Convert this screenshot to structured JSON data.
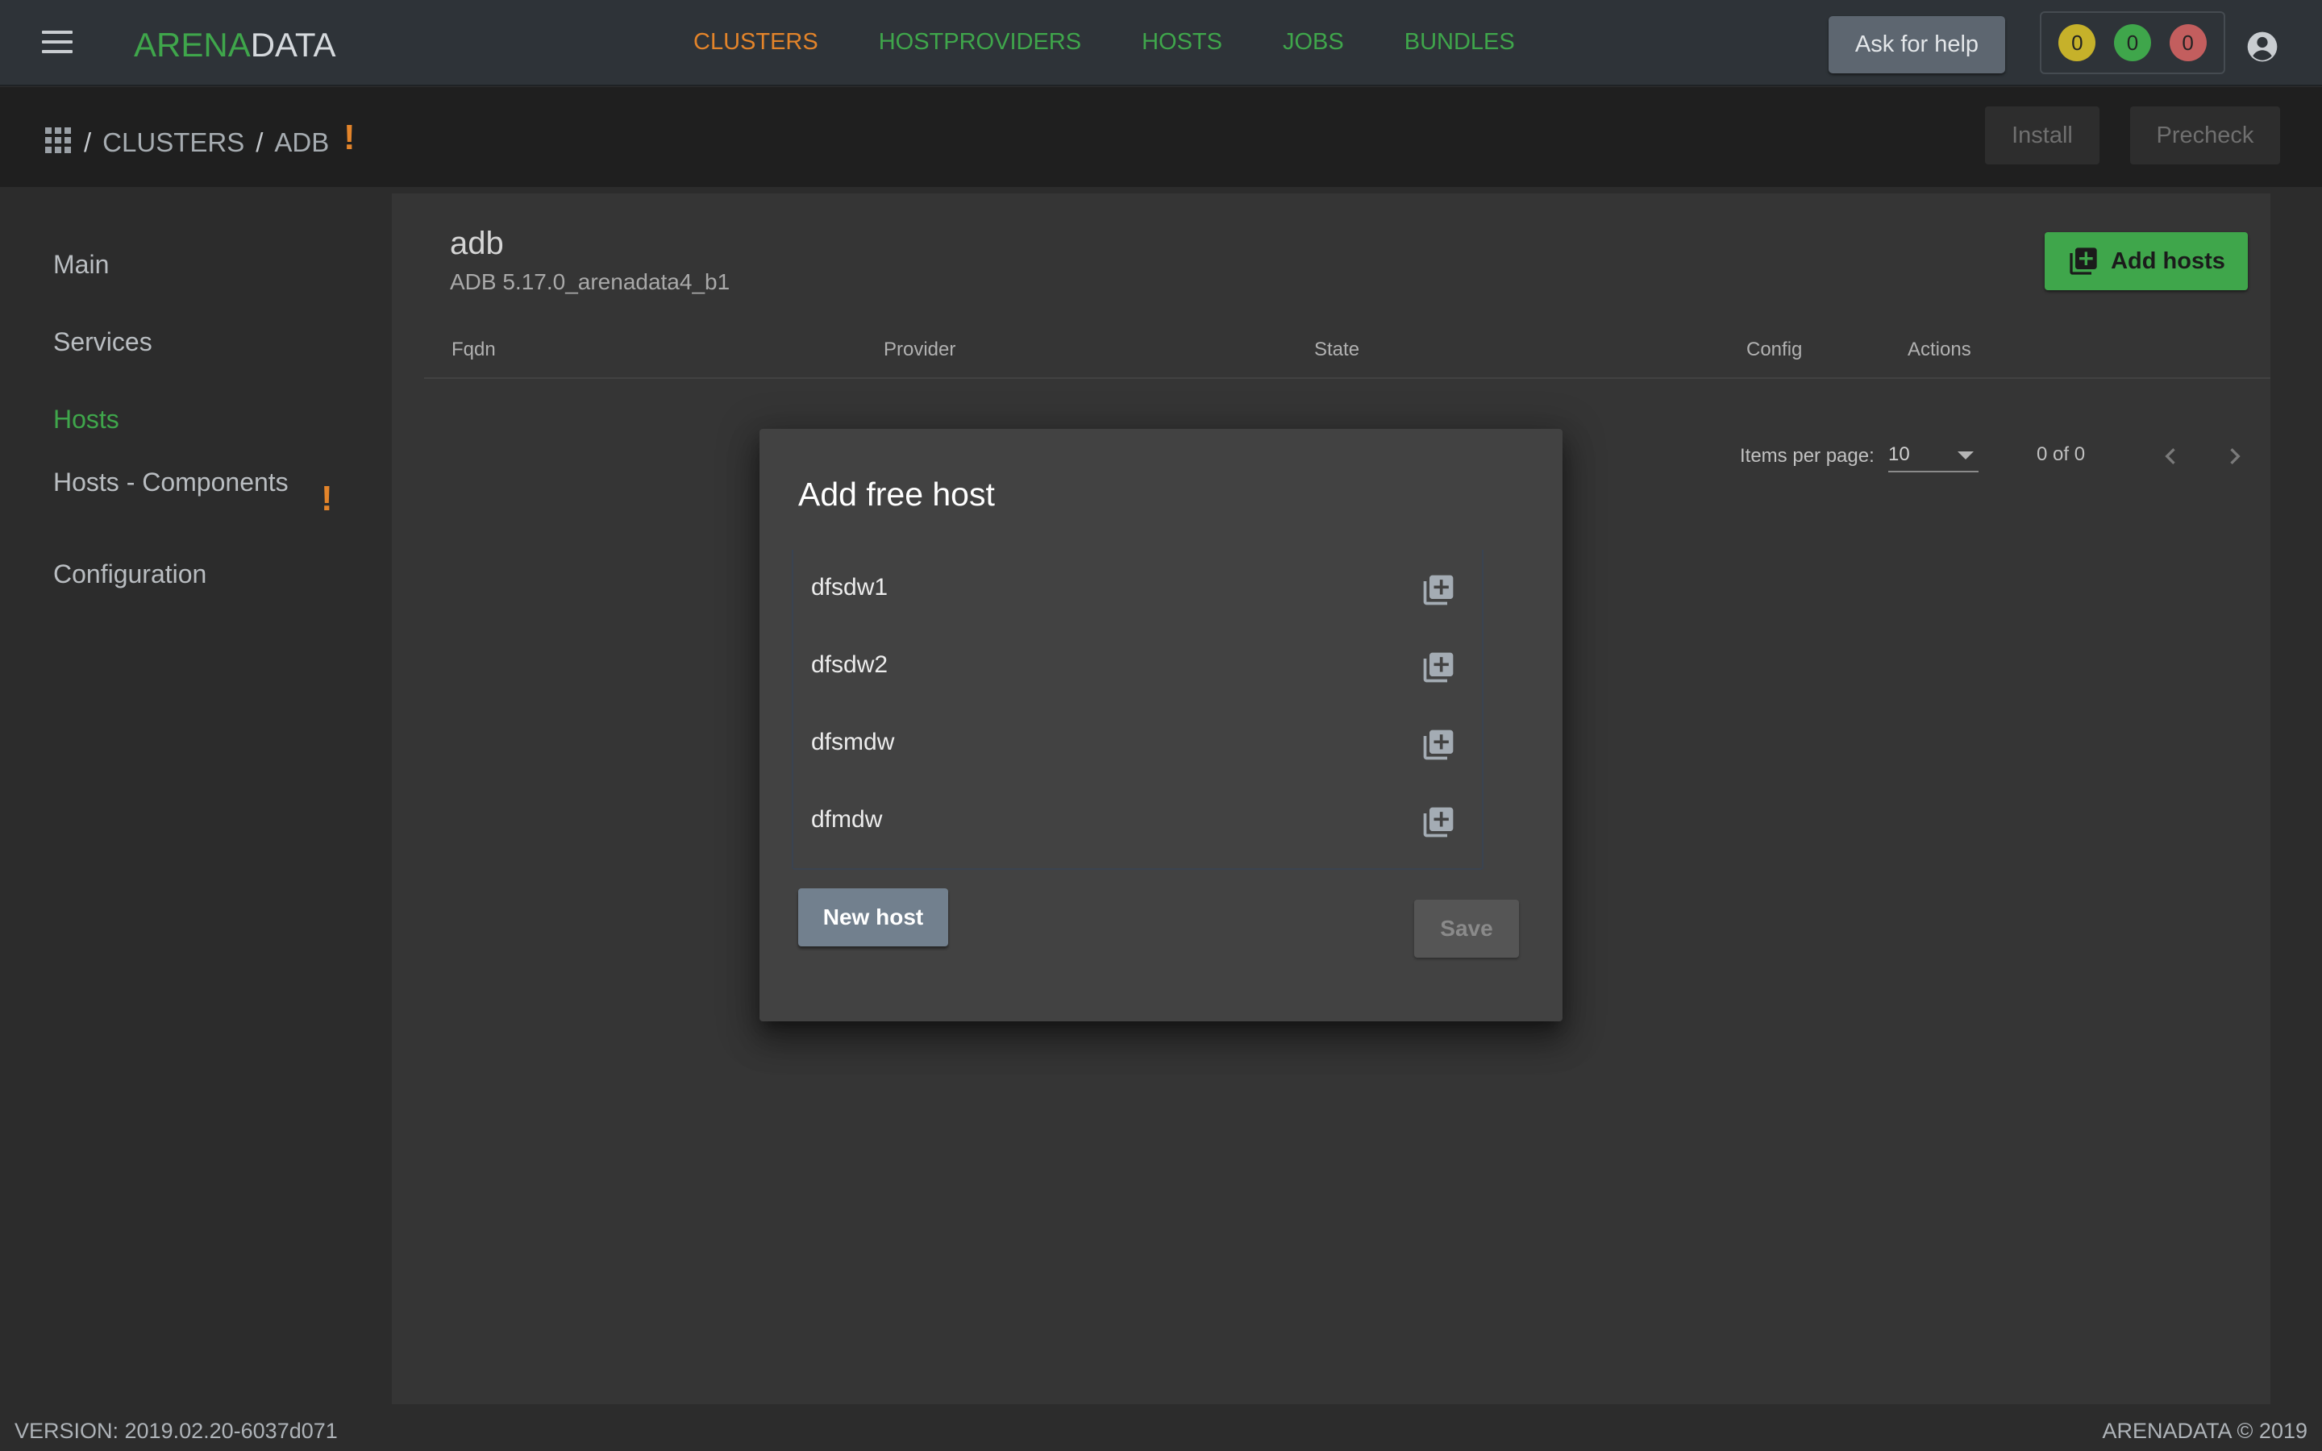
{
  "topbar": {
    "logo": {
      "part1": "ARENA",
      "part2": "DATA"
    },
    "nav": [
      {
        "label": "CLUSTERS",
        "active": true
      },
      {
        "label": "HOSTPROVIDERS",
        "active": false
      },
      {
        "label": "HOSTS",
        "active": false
      },
      {
        "label": "JOBS",
        "active": false
      },
      {
        "label": "BUNDLES",
        "active": false
      }
    ],
    "help_label": "Ask for help",
    "counters": [
      {
        "value": "0",
        "color": "#c6b12a"
      },
      {
        "value": "0",
        "color": "#3fa64b"
      },
      {
        "value": "0",
        "color": "#c35e5e"
      }
    ]
  },
  "breadcrumb": {
    "sep": "/",
    "items": [
      "CLUSTERS",
      "ADB"
    ],
    "warning": "!"
  },
  "actions": {
    "install": "Install",
    "precheck": "Precheck"
  },
  "sidebar": {
    "items": [
      {
        "label": "Main",
        "active": false
      },
      {
        "label": "Services",
        "active": false
      },
      {
        "label": "Hosts",
        "active": true
      },
      {
        "label": "Hosts - Components",
        "active": false,
        "warning": "!"
      },
      {
        "label": "Configuration",
        "active": false
      }
    ]
  },
  "main": {
    "cluster_name": "adb",
    "cluster_version": "ADB 5.17.0_arenadata4_b1",
    "add_hosts_label": "Add hosts",
    "columns": [
      "Fqdn",
      "Provider",
      "State",
      "Config",
      "Actions"
    ],
    "paginator": {
      "label": "Items per page:",
      "per_page": "10",
      "range": "0 of 0"
    }
  },
  "dialog": {
    "title": "Add free host",
    "hosts": [
      "dfsdw1",
      "dfsdw2",
      "dfsmdw",
      "dfmdw"
    ],
    "new_host_label": "New host",
    "save_label": "Save"
  },
  "footer": {
    "version": "VERSION: 2019.02.20-6037d071",
    "copyright": "ARENADATA © 2019"
  },
  "colors": {
    "accent_green": "#3fa64b",
    "accent_orange": "#e3842a"
  }
}
